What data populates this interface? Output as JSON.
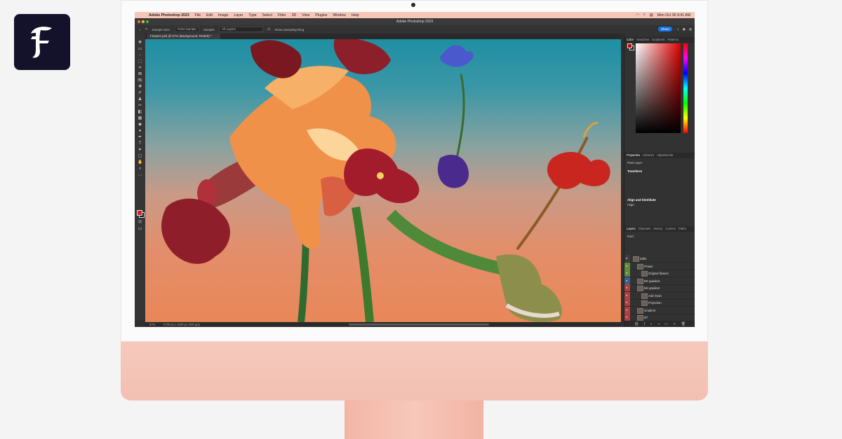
{
  "menubar": {
    "app_name": "Adobe Photoshop 2023",
    "menus": [
      "File",
      "Edit",
      "Image",
      "Layer",
      "Type",
      "Select",
      "Filter",
      "3D",
      "View",
      "Plugins",
      "Window",
      "Help"
    ],
    "clock": "Mon Oct 30  9:41 AM"
  },
  "window": {
    "title": "Adobe Photoshop 2023"
  },
  "options": {
    "sample_size_label": "Sample Size:",
    "sample_size_value": "Point Sample",
    "sample_label": "Sample:",
    "sample_value": "All Layers",
    "show_ring_label": "Show Sampling Ring",
    "share_label": "Share"
  },
  "document": {
    "tab_title": "Flowers.psb @ 57% (Background, RGB/8) *",
    "zoom": "57%",
    "dimensions": "6720 px x 4349 px (300 ppi)"
  },
  "panels": {
    "color_tabs": [
      "Color",
      "Swatches",
      "Gradients",
      "Patterns"
    ],
    "props_tabs": [
      "Properties",
      "Libraries",
      "Adjustments"
    ],
    "pixel_layer": "Pixel Layer",
    "transform": "Transform",
    "align": "Align and Distribute",
    "align_sub": "Align:",
    "layers_tabs": [
      "Layers",
      "Channels",
      "History",
      "Comme",
      "Paths"
    ],
    "kind": "Kind",
    "layers": [
      {
        "name": "Edits",
        "indent": 0,
        "eye": "#3c3c3c"
      },
      {
        "name": "Flower",
        "indent": 1,
        "eye": "#5e8c3a"
      },
      {
        "name": "Original flowers",
        "indent": 2,
        "eye": "#5e8c3a"
      },
      {
        "name": "BG gradient",
        "indent": 1,
        "eye": "#3a5f8c"
      },
      {
        "name": "BG gradient",
        "indent": 1,
        "eye": "#b04040"
      },
      {
        "name": "Add Grain",
        "indent": 2,
        "eye": "#b04040"
      },
      {
        "name": "Projection",
        "indent": 2,
        "eye": "#b04040"
      },
      {
        "name": "Gradient",
        "indent": 1,
        "eye": "#b04040"
      },
      {
        "name": "BT",
        "indent": 1,
        "eye": "#b04040"
      },
      {
        "name": "Background copy",
        "indent": 1,
        "eye": "#b04040"
      },
      {
        "name": "Background",
        "indent": 0,
        "eye": "#3c3c3c"
      }
    ]
  },
  "colors": {
    "imac_chin": "#f4c4b7",
    "menubar": "#f6c7b9",
    "share": "#1473e6",
    "logo_bg": "#14122a"
  }
}
